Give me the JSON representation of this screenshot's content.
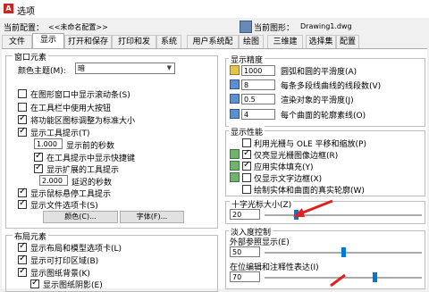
{
  "window": {
    "title": "选项"
  },
  "current_config": {
    "label": "当前配置：",
    "value": "<<未命名配置>>"
  },
  "current_drawing": {
    "label": "当前图形：",
    "value": "Drawing1.dwg"
  },
  "tabs": [
    "文件",
    "显示",
    "打开和保存",
    "打印和发布",
    "系统",
    "用户系统配置",
    "绘图",
    "三维建模",
    "选择集",
    "配置"
  ],
  "active_tab": "显示",
  "window_elements": {
    "title": "窗口元素",
    "color_scheme_label": "颜色主题(M):",
    "color_scheme_value": "暗",
    "show_scrollbars": "在图形窗口中显示滚动条(S)",
    "large_buttons": "在工具栏中使用大按钮",
    "resize_ribbon": "将功能区图标调整为标准大小",
    "show_tooltips": "显示工具提示(T)",
    "delay_label": "显示前的秒数",
    "delay_value": "1.000",
    "show_shortcuts": "在工具提示中显示快捷键",
    "show_extended": "显示扩展的工具提示",
    "extended_delay_value": "2.000",
    "extended_delay_label": "延迟的秒数",
    "show_rollover": "显示鼠标悬停工具提示",
    "show_file_tabs": "显示文件选项卡(S)",
    "colors_button": "颜色(C)...",
    "fonts_button": "字体(F)..."
  },
  "layout_elements": {
    "title": "布局元素",
    "show_layout_tabs": "显示布局和模型选项卡(L)",
    "show_printable_area": "显示可打印区域(B)",
    "show_paper_background": "显示图纸背景(K)",
    "show_paper_shadow": "显示图纸阴影(E)"
  },
  "display_resolution": {
    "title": "显示精度",
    "items": [
      {
        "value": "1000",
        "label": "圆弧和圆的平滑度(A)"
      },
      {
        "value": "8",
        "label": "每条多段线曲线的线段数(V)"
      },
      {
        "value": "0.5",
        "label": "渲染对象的平滑度(J)"
      },
      {
        "value": "4",
        "label": "每个曲面的轮廓素线(O)"
      }
    ]
  },
  "display_performance": {
    "title": "显示性能",
    "items": [
      {
        "label": "利用光栅与 OLE 平移和缩放(P)",
        "checked": false
      },
      {
        "label": "仅亮显光栅图像边框(R)",
        "checked": true
      },
      {
        "label": "应用实体填充(Y)",
        "checked": true
      },
      {
        "label": "仅显示文字边框(X)",
        "checked": false
      },
      {
        "label": "绘制实体和曲面的真实轮廓(W)",
        "checked": false
      }
    ]
  },
  "crosshair": {
    "title": "十字光标大小(Z)",
    "value": "20",
    "level_percent": 20
  },
  "fade_control": {
    "title": "淡入度控制",
    "xref_label": "外部参照显示(E)",
    "xref_value": "50",
    "xref_level_percent": 50,
    "inplace_label": "在位编辑和注释性表达(I)",
    "inplace_value": "70",
    "inplace_level_percent": 70
  },
  "colors": {
    "accent": "#0078d7",
    "arrow": "#e02020"
  }
}
